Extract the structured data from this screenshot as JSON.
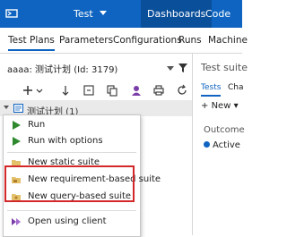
{
  "topbar": {
    "project": "Test",
    "nav": [
      "Dashboards",
      "Code"
    ]
  },
  "tabs": [
    "Test Plans",
    "Parameters",
    "Configurations",
    "Runs",
    "Machine"
  ],
  "plan_selector": {
    "value": "aaaa: 测试计划 (Id: 3179)"
  },
  "tree": {
    "root_label": "测试计划 (1)"
  },
  "context_menu": {
    "items": [
      {
        "label": "Run",
        "icon": "run-icon"
      },
      {
        "label": "Run with options",
        "icon": "run-with-options-icon"
      },
      {
        "label": "New static suite",
        "icon": "folder-icon"
      },
      {
        "label": "New requirement-based suite",
        "icon": "requirement-suite-icon"
      },
      {
        "label": "New query-based suite",
        "icon": "query-suite-icon"
      },
      {
        "label": "Open using client",
        "icon": "open-client-icon"
      }
    ],
    "highlight_color": "#d3282a"
  },
  "right_panel": {
    "title": "Test suite",
    "tabs": [
      "Tests",
      "Cha"
    ],
    "new_label": "New",
    "outcome_label": "Outcome",
    "active_label": "Active"
  },
  "colors": {
    "accent": "#0e64c0",
    "run_green": "#2f8a2f",
    "folder": "#e3c06a"
  }
}
